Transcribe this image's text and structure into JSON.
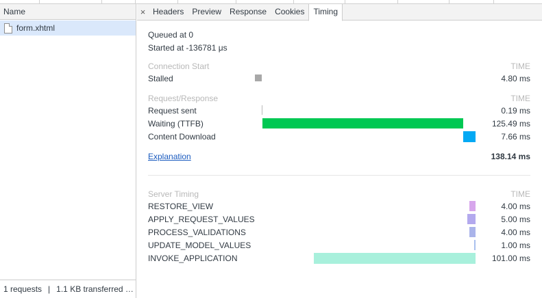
{
  "left": {
    "header": "Name",
    "file": "form.xhtml",
    "status": {
      "requests": "1 requests",
      "separator": "|",
      "transferred": "1.1 KB transferred …"
    }
  },
  "tabs": {
    "close": "×",
    "items": [
      "Headers",
      "Preview",
      "Response",
      "Cookies",
      "Timing"
    ],
    "active": "Timing"
  },
  "timing": {
    "queued": "Queued at 0",
    "started": "Started at -136781 μs",
    "connection": {
      "title": "Connection Start",
      "time_header": "TIME",
      "rows": [
        {
          "label": "Stalled",
          "value": "4.80 ms",
          "color": "#a8a8a8"
        }
      ]
    },
    "request": {
      "title": "Request/Response",
      "time_header": "TIME",
      "rows": [
        {
          "label": "Request sent",
          "value": "0.19 ms",
          "color": "#b9b9b9"
        },
        {
          "label": "Waiting (TTFB)",
          "value": "125.49 ms",
          "color": "#00c853"
        },
        {
          "label": "Content Download",
          "value": "7.66 ms",
          "color": "#03a9f4"
        }
      ]
    },
    "explanation": "Explanation",
    "total": "138.14 ms",
    "server": {
      "title": "Server Timing",
      "time_header": "TIME",
      "rows": [
        {
          "label": "RESTORE_VIEW",
          "value": "4.00 ms",
          "color": "#d7a6ec"
        },
        {
          "label": "APPLY_REQUEST_VALUES",
          "value": "5.00 ms",
          "color": "#b3a9ee"
        },
        {
          "label": "PROCESS_VALIDATIONS",
          "value": "4.00 ms",
          "color": "#aab4ea"
        },
        {
          "label": "UPDATE_MODEL_VALUES",
          "value": "1.00 ms",
          "color": "#a9c0ee"
        },
        {
          "label": "INVOKE_APPLICATION",
          "value": "101.00 ms",
          "color": "#a8f0dc"
        }
      ]
    }
  }
}
